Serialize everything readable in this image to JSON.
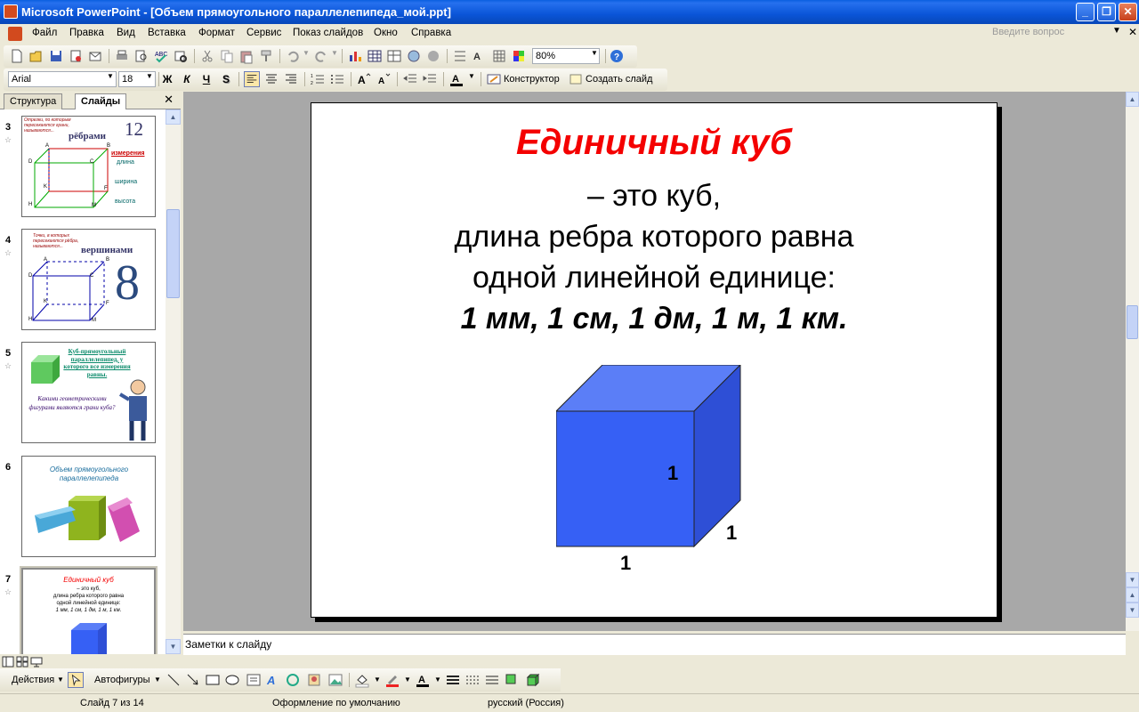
{
  "window": {
    "title": "Microsoft PowerPoint - [Объем прямоугольного параллелепипеда_мой.ppt]",
    "buttons": [
      "_",
      "❐",
      "✕"
    ]
  },
  "menu": {
    "items": [
      "Файл",
      "Правка",
      "Вид",
      "Вставка",
      "Формат",
      "Сервис",
      "Показ слайдов",
      "Окно",
      "Справка"
    ],
    "help_placeholder": "Введите вопрос"
  },
  "toolbar": {
    "zoom": "80%"
  },
  "format_toolbar": {
    "font": "Arial",
    "size": "18",
    "bold": "Ж",
    "italic": "К",
    "underline": "Ч",
    "shadow": "S",
    "designer": "Конструктор",
    "new_slide": "Создать слайд"
  },
  "left_pane": {
    "tabs": [
      "Структура",
      "Слайды"
    ],
    "slides": [
      {
        "num": "3",
        "title_small": "Отрезки, по которым пересекаются грани, называются...",
        "big": "рёбрами",
        "count": "12",
        "side": [
          "измерения",
          "длина",
          "ширина",
          "высота"
        ],
        "vertex_labels": [
          "A",
          "B",
          "D",
          "C",
          "K",
          "F",
          "H",
          "M"
        ]
      },
      {
        "num": "4",
        "title_small": "Точки, в которых пересекаются рёбра, называются...",
        "big": "вершинами",
        "count": "8",
        "vertex_labels": [
          "A",
          "B",
          "D",
          "C",
          "K",
          "F",
          "H",
          "M"
        ]
      },
      {
        "num": "5",
        "heading": "Куб-прямоугольный параллелепипед, у которого все измерения равны.",
        "question": "Какими геометрическими фигурами являются грани куба?"
      },
      {
        "num": "6",
        "heading": "Объем прямоугольного параллелепипеда"
      },
      {
        "num": "7",
        "title": "Единичный куб",
        "line1": "– это куб,",
        "line2": "длина ребра которого равна",
        "line3": "одной линейной единице:",
        "units": "1 мм, 1 см, 1 дм, 1 м, 1 км."
      }
    ]
  },
  "slide": {
    "title": "Единичный куб",
    "line1": "– это куб,",
    "line2": "длина ребра которого равна",
    "line3": "одной линейной единице:",
    "units": "1 мм, 1 см, 1 дм, 1 м, 1 км.",
    "cube_labels": [
      "1",
      "1",
      "1"
    ],
    "colors": {
      "title": "#F40000",
      "cube_front": "#3660F5",
      "cube_top": "#5B7EF7",
      "cube_side": "#2E4FD6"
    }
  },
  "notes": {
    "placeholder": "Заметки к слайду"
  },
  "drawing": {
    "actions": "Действия",
    "autoshapes": "Автофигуры"
  },
  "status": {
    "slide": "Слайд 7 из 14",
    "design": "Оформление по умолчанию",
    "language": "русский (Россия)"
  }
}
